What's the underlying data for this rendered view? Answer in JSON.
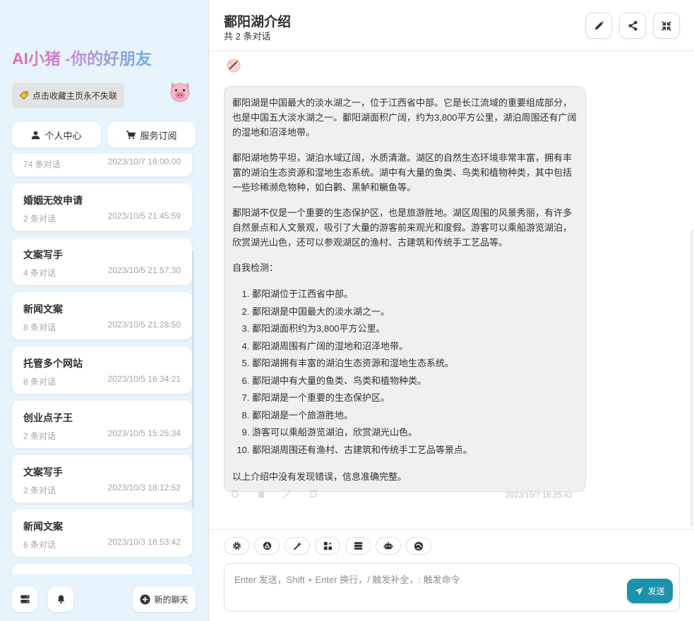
{
  "sidebar": {
    "brand": "AI小猪 -你的好朋友",
    "bookmark_text": "点击收藏主页永不失联",
    "user_center_label": "个人中心",
    "subscription_label": "服务订阅",
    "partial_top_item": {
      "count": "74 条对话",
      "time": "2023/10/7 16:00:00"
    },
    "chats": [
      {
        "title": "婚姻无效申请",
        "count": "2 条对话",
        "time": "2023/10/5 21:45:59"
      },
      {
        "title": "文案写手",
        "count": "4 条对话",
        "time": "2023/10/5 21:57:30"
      },
      {
        "title": "新闻文案",
        "count": "8 条对话",
        "time": "2023/10/5 21:28:50"
      },
      {
        "title": "托管多个网站",
        "count": "8 条对话",
        "time": "2023/10/5 16:34:21"
      },
      {
        "title": "创业点子王",
        "count": "2 条对话",
        "time": "2023/10/5 15:25:34"
      },
      {
        "title": "文案写手",
        "count": "2 条对话",
        "time": "2023/10/3 18:12:52"
      },
      {
        "title": "新闻文案",
        "count": "6 条对话",
        "time": "2023/10/3 18:53:42"
      }
    ],
    "new_chat_label": "新的聊天"
  },
  "header": {
    "title": "鄱阳湖介绍",
    "subtitle": "共 2 条对话"
  },
  "message": {
    "p1": "鄱阳湖是中国最大的淡水湖之一，位于江西省中部。它是长江流域的重要组成部分，也是中国五大淡水湖之一。鄱阳湖面积广阔，约为3,800平方公里，湖泊周围还有广阔的湿地和沼泽地带。",
    "p2": "鄱阳湖地势平坦，湖泊水域辽阔，水质清澈。湖区的自然生态环境非常丰富，拥有丰富的湖泊生态资源和湿地生态系统。湖中有大量的鱼类、鸟类和植物种类，其中包括一些珍稀濒危物种，如白鹳、黑鲈和鳜鱼等。",
    "p3": "鄱阳湖不仅是一个重要的生态保护区，也是旅游胜地。湖区周围的风景秀丽，有许多自然景点和人文景观，吸引了大量的游客前来观光和度假。游客可以乘船游览湖泊，欣赏湖光山色，还可以参观湖区的渔村、古建筑和传统手工艺品等。",
    "check_heading": "自我检测：",
    "checks": [
      "鄱阳湖位于江西省中部。",
      "鄱阳湖是中国最大的淡水湖之一。",
      "鄱阳湖面积约为3,800平方公里。",
      "鄱阳湖周围有广阔的湿地和沼泽地带。",
      "鄱阳湖拥有丰富的湖泊生态资源和湿地生态系统。",
      "鄱阳湖中有大量的鱼类、鸟类和植物种类。",
      "鄱阳湖是一个重要的生态保护区。",
      "鄱阳湖是一个旅游胜地。",
      "游客可以乘船游览湖泊，欣赏湖光山色。",
      "鄱阳湖周围还有渔村、古建筑和传统手工艺品等景点。"
    ],
    "conclusion": "以上介绍中没有发现错误，信息准确完整。",
    "time": "2023/10/7 18:25:42"
  },
  "input": {
    "placeholder": "Enter 发送，Shift + Enter 换行，/ 触发补全，: 触发命令",
    "send_label": "发送"
  },
  "colors": {
    "accent": "#1d93ab",
    "sidebar_bg": "#e8f4fb",
    "bubble_bg": "#f0f0f0"
  },
  "icons": {
    "header": [
      "edit-icon",
      "share-icon",
      "shrink-icon"
    ],
    "tools": [
      "settings-icon",
      "prompt-icon",
      "magic-wand-icon",
      "mask-icon",
      "storage-icon",
      "robot-icon",
      "plugin-icon"
    ]
  }
}
